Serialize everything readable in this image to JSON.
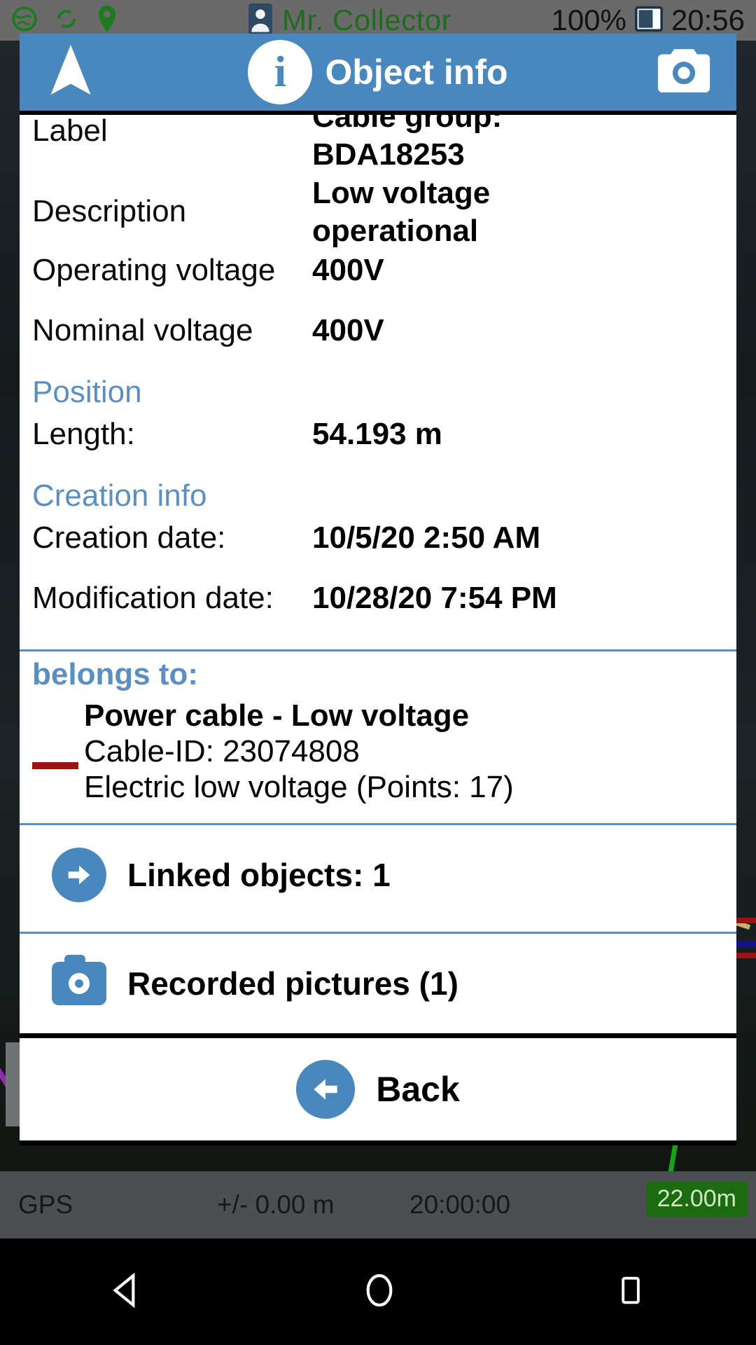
{
  "status_bar": {
    "icons": [
      "globe-icon",
      "sync-icon",
      "location-pin-icon",
      "contact-icon"
    ],
    "user_name": "Mr. Collector",
    "battery_percent": "100%",
    "clock": "20:56"
  },
  "header": {
    "nav_icon": "navigation-arrow-icon",
    "info_icon": "i",
    "title": "Object info",
    "camera_icon": "camera-icon"
  },
  "properties": [
    {
      "label": "Label",
      "value_clipped": "Cable group:",
      "value": "BDA18253"
    },
    {
      "label": "Description",
      "value": "Low voltage operational"
    },
    {
      "label": "Operating voltage",
      "value": "400V"
    },
    {
      "label": "Nominal voltage",
      "value": "400V"
    }
  ],
  "sections": {
    "position": {
      "title": "Position",
      "length_label": "Length:",
      "length_value": "54.193 m"
    },
    "creation": {
      "title": "Creation info",
      "creation_label": "Creation date:",
      "creation_value": "10/5/20 2:50 AM",
      "modification_label": "Modification date:",
      "modification_value": "10/28/20 7:54 PM"
    }
  },
  "belongs_to": {
    "title": "belongs to:",
    "swatch_color": "#9c1111",
    "line1": "Power cable - Low voltage",
    "line2": "Cable-ID: 23074808",
    "line3": "Electric low voltage (Points: 17)"
  },
  "actions": [
    {
      "icon": "arrow-right-circle-icon",
      "label": "Linked objects: 1"
    },
    {
      "icon": "camera-icon",
      "label": "Recorded pictures (1)"
    }
  ],
  "back_button": {
    "icon": "arrow-left-circle-icon",
    "label": "Back"
  },
  "map_status_bar": {
    "gps_label": "GPS",
    "accuracy": "+/- 0.00 m",
    "time": "20:00:00",
    "scale_badge": "22.00m"
  },
  "android_nav": {
    "back": "triangle-back-icon",
    "home": "circle-home-icon",
    "recents": "square-recents-icon"
  },
  "colors": {
    "accent_blue": "#4a87bc",
    "section_blue": "#5b8fc0",
    "status_green": "#1f6b1f",
    "swatch_red": "#9c1111"
  }
}
